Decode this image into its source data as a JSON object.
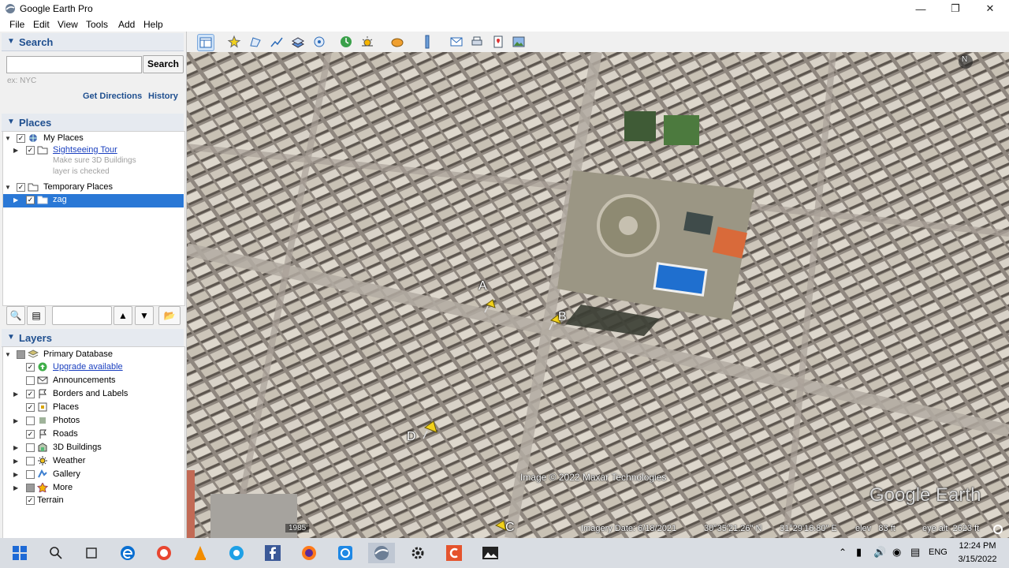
{
  "window": {
    "title": "Google Earth Pro"
  },
  "menu": [
    "File",
    "Edit",
    "View",
    "Tools",
    "Add",
    "Help"
  ],
  "search": {
    "header": "Search",
    "placeholder": "",
    "button": "Search",
    "hint": "ex: NYC",
    "get_directions": "Get Directions",
    "history": "History"
  },
  "places": {
    "header": "Places",
    "items": [
      {
        "label": "My Places",
        "checked": true,
        "icon": "globe-icon"
      },
      {
        "label": "Sightseeing Tour",
        "checked": true,
        "icon": "folder-icon",
        "link": true
      },
      {
        "label": "Make sure 3D Buildings",
        "note": true
      },
      {
        "label": "layer is checked",
        "note": true
      },
      {
        "label": "Temporary Places",
        "checked": true,
        "icon": "folder-icon"
      },
      {
        "label": "zag",
        "checked": true,
        "icon": "folder-icon",
        "selected": true
      }
    ]
  },
  "layers": {
    "header": "Layers",
    "items": [
      {
        "label": "Primary Database",
        "checked": "partial",
        "icon": "layers-icon"
      },
      {
        "label": "Upgrade available",
        "checked": true,
        "icon": "upgrade-icon",
        "link": true
      },
      {
        "label": "Announcements",
        "checked": false,
        "icon": "envelope-icon"
      },
      {
        "label": "Borders and Labels",
        "checked": true,
        "icon": "flag-icon"
      },
      {
        "label": "Places",
        "checked": true,
        "icon": "places-icon"
      },
      {
        "label": "Photos",
        "checked": false,
        "icon": "photo-icon"
      },
      {
        "label": "Roads",
        "checked": true,
        "icon": "road-icon"
      },
      {
        "label": "3D Buildings",
        "checked": false,
        "icon": "building-icon"
      },
      {
        "label": "Weather",
        "checked": false,
        "icon": "sun-icon"
      },
      {
        "label": "Gallery",
        "checked": false,
        "icon": "gallery-icon"
      },
      {
        "label": "More",
        "checked": "partial",
        "icon": "star-icon"
      },
      {
        "label": "Terrain",
        "checked": true,
        "icon": "terrain"
      }
    ]
  },
  "map": {
    "pins": [
      "A",
      "B",
      "C",
      "D"
    ],
    "image_credit": "Image © 2022 Maxar Technologies",
    "logo": "Google Earth",
    "historical_year": "1985",
    "north": "N",
    "status": {
      "imagery_date": "Imagery Date: 6/18/2021",
      "lat": "30°35'21.26\" N",
      "lon": "31°29'16.80\" E",
      "elev": "elev   83 ft",
      "eye_alt": "eye alt  2623 ft"
    }
  },
  "taskbar": {
    "language": "ENG",
    "time": "12:24 PM",
    "date": "3/15/2022"
  },
  "colors": {
    "selection": "#2a78d6",
    "panel_header": "#1f4f8f",
    "pin": "#f2d11c"
  }
}
